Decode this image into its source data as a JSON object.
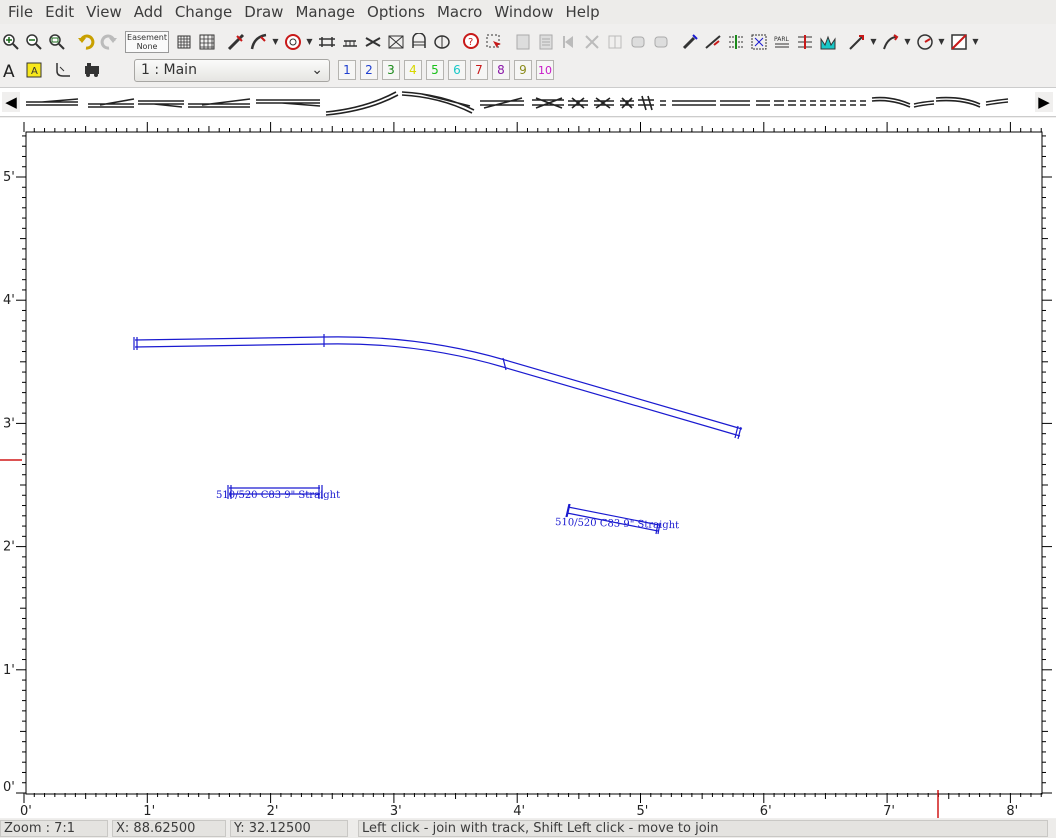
{
  "menu": [
    "File",
    "Edit",
    "View",
    "Add",
    "Change",
    "Draw",
    "Manage",
    "Options",
    "Macro",
    "Window",
    "Help"
  ],
  "toolbar": {
    "easement_line1": "Easement",
    "easement_line2": "None",
    "layer_select_value": "1 : Main",
    "layer_buttons": [
      {
        "label": "1",
        "color": "#1f3fd0"
      },
      {
        "label": "2",
        "color": "#1f3fd0"
      },
      {
        "label": "3",
        "color": "#1a8a1a"
      },
      {
        "label": "4",
        "color": "#d8d800"
      },
      {
        "label": "5",
        "color": "#19c019"
      },
      {
        "label": "6",
        "color": "#19c8c8"
      },
      {
        "label": "7",
        "color": "#c81919"
      },
      {
        "label": "8",
        "color": "#8a19a8"
      },
      {
        "label": "9",
        "color": "#8a8a19"
      },
      {
        "label": "10",
        "color": "#c819c8"
      }
    ]
  },
  "canvas": {
    "x_axis_labels": [
      "0'",
      "1'",
      "2'",
      "3'",
      "4'",
      "5'",
      "6'",
      "7'",
      "8'"
    ],
    "y_axis_labels": [
      "0'",
      "1'",
      "2'",
      "3'",
      "4'",
      "5'"
    ],
    "track_color": "#1a1ad0",
    "labels": [
      {
        "id": "straight-label-1",
        "text": "510/520 C83 9\" Straight"
      },
      {
        "id": "straight-label-2",
        "text": "510/520 C83 9\" Straight"
      }
    ]
  },
  "status": {
    "zoom": "Zoom : 7:1",
    "x": "X: 88.62500",
    "y": "Y: 32.12500",
    "message": "Left click - join with track, Shift Left click - move to join"
  }
}
